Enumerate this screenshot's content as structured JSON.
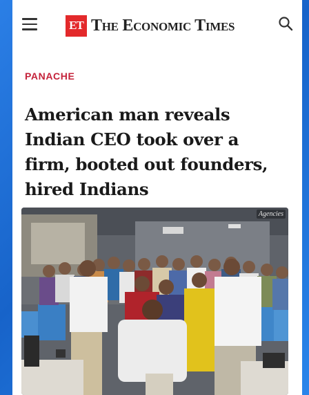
{
  "header": {
    "logo_mark": "ET",
    "logo_text": "The Economic Times"
  },
  "article": {
    "section": "PANACHE",
    "headline": "American man reveals Indian CEO took over a firm, booted out founders, hired Indians",
    "photo_credit": "Agencies"
  },
  "icons": {
    "menu": "hamburger-menu-icon",
    "search": "search-icon"
  },
  "colors": {
    "background": "#1f6fd6",
    "brand_red": "#e3292b",
    "section_label": "#c4223a"
  }
}
